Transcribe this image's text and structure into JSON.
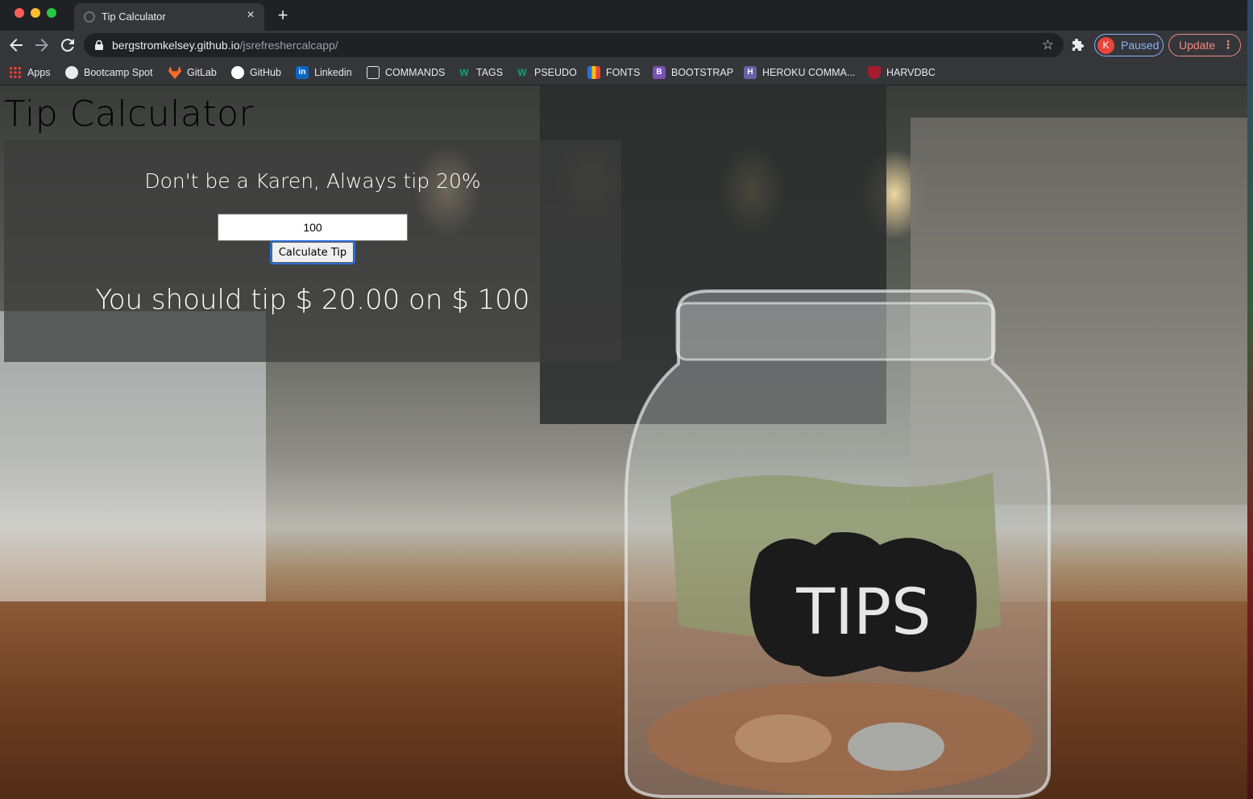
{
  "browser": {
    "tab": {
      "title": "Tip Calculator",
      "close_glyph": "×"
    },
    "new_tab_glyph": "+",
    "url": {
      "host": "bergstromkelsey.github.io",
      "path": "/jsrefreshercalcapp/"
    },
    "profile": {
      "initial": "K",
      "label": "Paused"
    },
    "update": {
      "label": "Update",
      "menu_glyph": "⋮"
    },
    "bookmarks": [
      {
        "label": "Apps",
        "icon": "apps-grid-icon",
        "color": "#4285f4"
      },
      {
        "label": "Bootcamp Spot",
        "icon": "globe-icon",
        "color": "#e8eaed"
      },
      {
        "label": "GitLab",
        "icon": "gitlab-icon",
        "color": "#fc6d26"
      },
      {
        "label": "GitHub",
        "icon": "github-icon",
        "color": "#ffffff"
      },
      {
        "label": "Linkedin",
        "icon": "linkedin-icon",
        "color": "#0a66c2"
      },
      {
        "label": "COMMANDS",
        "icon": "terminal-icon",
        "color": "#e8eaed"
      },
      {
        "label": "TAGS",
        "icon": "w3schools-icon",
        "color": "#04aa6d"
      },
      {
        "label": "PSEUDO",
        "icon": "w3schools-icon",
        "color": "#04aa6d"
      },
      {
        "label": "FONTS",
        "icon": "fonts-icon",
        "color": "#2a6fd6"
      },
      {
        "label": "BOOTSTRAP",
        "icon": "bootstrap-icon",
        "color": "#7952b3"
      },
      {
        "label": "HEROKU COMMA...",
        "icon": "heroku-icon",
        "color": "#6762a6"
      },
      {
        "label": "HARVDBC",
        "icon": "harvard-icon",
        "color": "#a51c30"
      }
    ]
  },
  "page": {
    "title": "Tip Calculator",
    "tagline": "Don't be a Karen, Always tip 20%",
    "amount_input": {
      "value": "100"
    },
    "calculate_button": "Calculate Tip",
    "result": "You should tip $ 20.00 on $ 100",
    "background_jar_label": "TIPS"
  }
}
